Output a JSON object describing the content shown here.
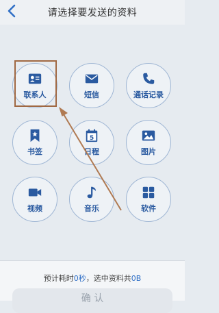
{
  "header": {
    "back_icon": "chevron-left-icon",
    "title": "请选择要发送的资料"
  },
  "items": [
    {
      "label": "联系人",
      "icon": "contact-card-icon"
    },
    {
      "label": "短信",
      "icon": "envelope-icon"
    },
    {
      "label": "通话记录",
      "icon": "phone-icon"
    },
    {
      "label": "书签",
      "icon": "bookmark-icon"
    },
    {
      "label": "日程",
      "icon": "calendar-icon",
      "calendar_day": "5"
    },
    {
      "label": "图片",
      "icon": "image-icon"
    },
    {
      "label": "视频",
      "icon": "video-camera-icon"
    },
    {
      "label": "音乐",
      "icon": "music-note-icon"
    },
    {
      "label": "软件",
      "icon": "apps-grid-icon"
    }
  ],
  "footer": {
    "estimate_prefix": "预计耗时",
    "time_value": "0秒",
    "estimate_middle": "，选中资料共",
    "size_value": "0B",
    "confirm_label": "确 认"
  },
  "colors": {
    "accent": "#2f6fc6",
    "icon_blue": "#2a5aa0",
    "highlight_box": "#a06842",
    "arrow": "#b07a52"
  }
}
